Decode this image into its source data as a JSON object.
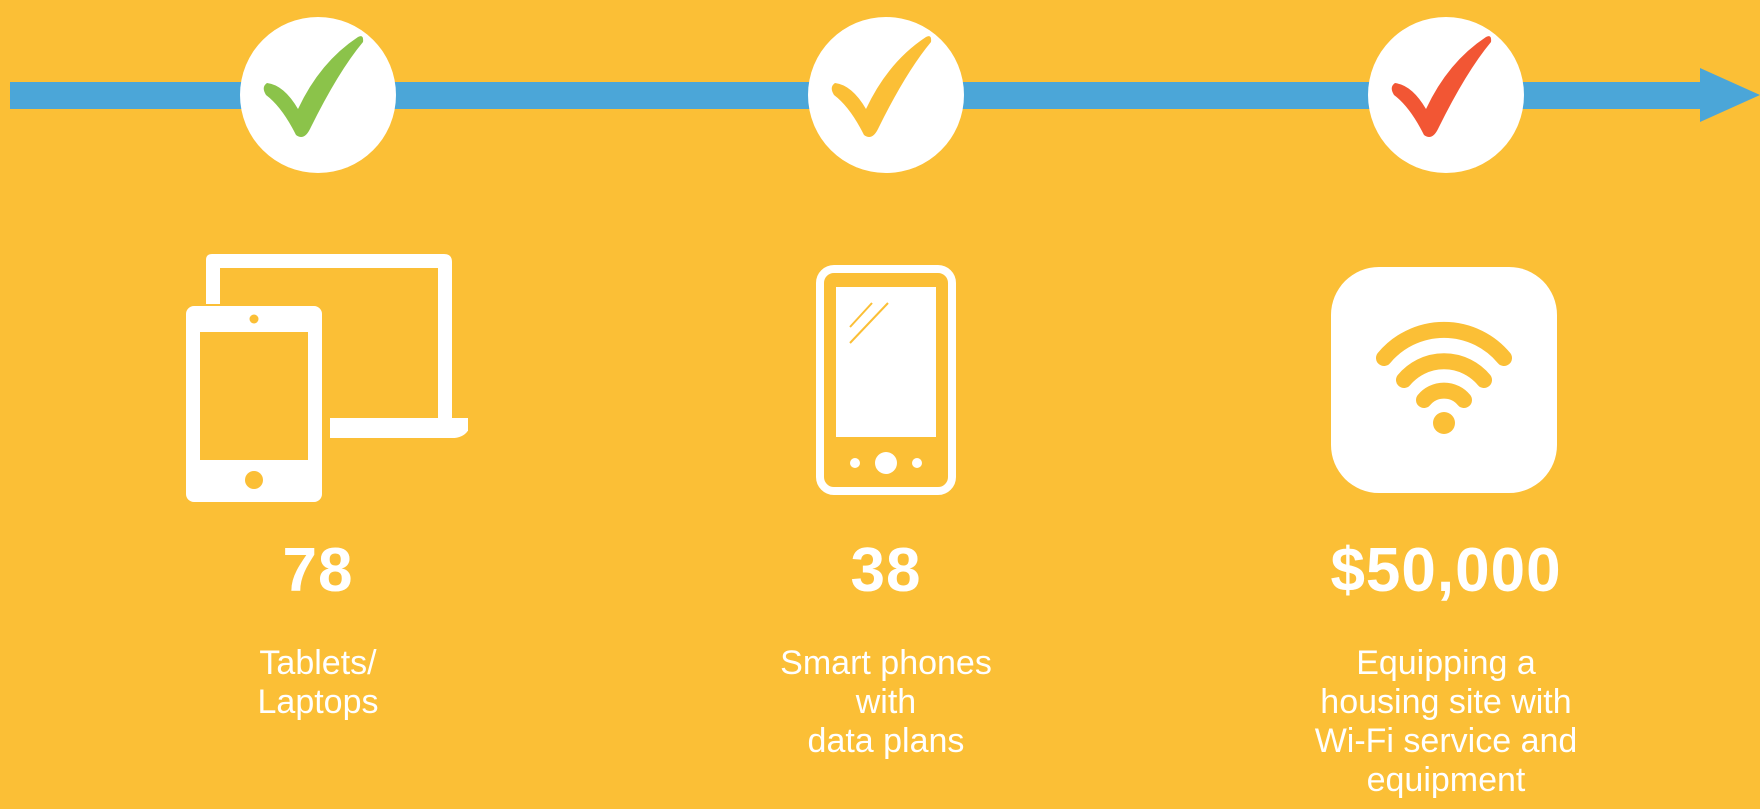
{
  "colors": {
    "background": "#FBBF36",
    "timeline": "#4BA6D8",
    "check_green": "#8BC34A",
    "check_yellow": "#FBBF36",
    "check_red": "#F25634",
    "icon": "#FFFFFF"
  },
  "timeline": {
    "milestones": [
      {
        "icon": "check-icon",
        "color": "#8BC34A"
      },
      {
        "icon": "check-icon",
        "color": "#FBBF36"
      },
      {
        "icon": "check-icon",
        "color": "#F25634"
      }
    ]
  },
  "stats": [
    {
      "icon": "devices-icon",
      "value": "78",
      "description": "Tablets/\nLaptops"
    },
    {
      "icon": "smartphone-icon",
      "value": "38",
      "description": "Smart phones\nwith\ndata plans"
    },
    {
      "icon": "wifi-icon",
      "value": "$50,000",
      "description": "Equipping a\nhousing site with\nWi-Fi service and\nequipment"
    }
  ]
}
